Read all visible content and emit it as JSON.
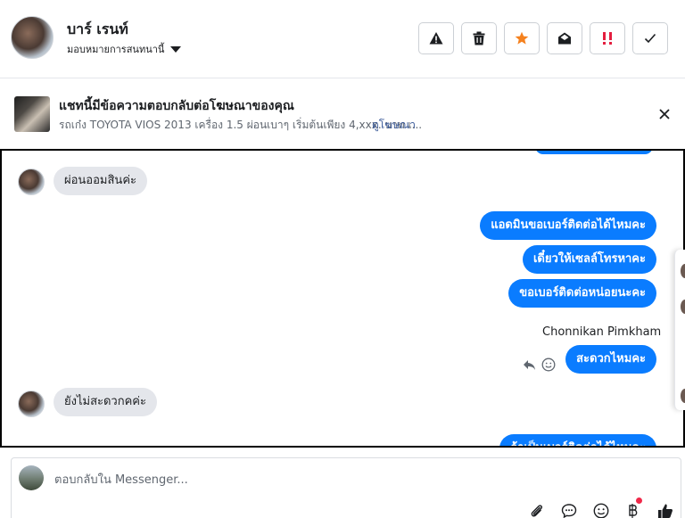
{
  "header": {
    "contact_name": "บาร์ เรนท์",
    "assign_label": "มอบหมายการสนทนานี้",
    "toolbar": [
      {
        "name": "report-spam-button",
        "icon": "warning-icon"
      },
      {
        "name": "delete-button",
        "icon": "trash-icon"
      },
      {
        "name": "star-button",
        "icon": "star-icon",
        "color": "#f5811e"
      },
      {
        "name": "mark-unread-button",
        "icon": "envelope-open-icon"
      },
      {
        "name": "follow-up-button",
        "icon": "double-exclamation-icon",
        "color": "#e41e3f"
      },
      {
        "name": "mark-done-button",
        "icon": "check-icon"
      }
    ]
  },
  "ad_banner": {
    "title": "แชทนี้มีข้อความตอบกลับต่อโฆษณาของคุณ",
    "description": "รถเก๋ง TOYOTA VIOS 2013 เครื่อง 1.5 ผ่อนเบาๆ เริ่มต้นเพียง 4,xxx. บาท เ...",
    "link_label": "ดูโฆษณา"
  },
  "conversation": {
    "messages": [
      {
        "id": "m1",
        "direction": "in",
        "text": "ผ่อนออมสินค่ะ"
      },
      {
        "id": "m2",
        "direction": "out",
        "text": "แอดมินขอเบอร์ติดต่อได้ไหมคะ"
      },
      {
        "id": "m3",
        "direction": "out",
        "text": "เดี๋ยวให้เซลล์โทรหาคะ"
      },
      {
        "id": "m4",
        "direction": "out",
        "text": "ขอเบอร์ติดต่อหน่อยนะคะ"
      },
      {
        "id": "m5",
        "direction": "out",
        "text": "สะดวกไหมคะ",
        "sender": "Chonnikan Pimkham"
      },
      {
        "id": "m6",
        "direction": "in",
        "text": "ยังไม่สะดวกคค่ะ"
      },
      {
        "id": "m7",
        "direction": "out",
        "text": "ถ้าเป็นเบอร์ติดต่อได้ไหมคะ"
      }
    ]
  },
  "composer": {
    "placeholder": "ตอบกลับใน Messenger..."
  },
  "colors": {
    "accent_blue": "#0a7cff",
    "incoming_bubble": "#e4e6eb",
    "link": "#385898",
    "notification": "#f02849"
  }
}
